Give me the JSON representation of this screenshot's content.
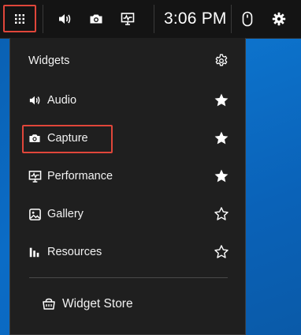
{
  "topbar": {
    "time": "3:06 PM",
    "icons": [
      "widget-menu-icon",
      "speaker-icon",
      "camera-icon",
      "performance-icon",
      "mouse-icon",
      "gear-icon"
    ]
  },
  "panel": {
    "title": "Widgets",
    "items": [
      {
        "label": "Audio",
        "icon": "speaker-icon",
        "favorite": true
      },
      {
        "label": "Capture",
        "icon": "camera-icon",
        "favorite": true
      },
      {
        "label": "Performance",
        "icon": "performance-icon",
        "favorite": true
      },
      {
        "label": "Gallery",
        "icon": "gallery-icon",
        "favorite": false
      },
      {
        "label": "Resources",
        "icon": "resources-icon",
        "favorite": false
      }
    ],
    "store_label": "Widget Store"
  },
  "colors": {
    "highlight": "#e0463a",
    "panel": "#1f1f1f",
    "bar": "#141414"
  }
}
